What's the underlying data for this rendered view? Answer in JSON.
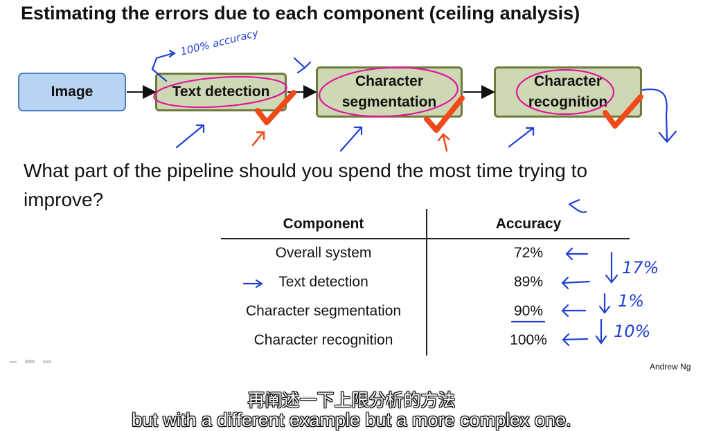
{
  "slide": {
    "title": "Estimating the errors due to each component (ceiling analysis)",
    "pipeline": {
      "image_label": "Image",
      "stages": [
        "Text detection",
        "Character segmentation",
        "Character recognition"
      ]
    },
    "question": "What part of the pipeline should you spend the most time trying to improve?",
    "table": {
      "headers": [
        "Component",
        "Accuracy"
      ],
      "rows": [
        {
          "component": "Overall system",
          "accuracy": "72%"
        },
        {
          "component": "Text detection",
          "accuracy": "89%"
        },
        {
          "component": "Character segmentation",
          "accuracy": "90%"
        },
        {
          "component": "Character recognition",
          "accuracy": "100%"
        }
      ]
    },
    "author": "Andrew Ng",
    "annotations": {
      "accuracy_note": "100% accuracy",
      "diffs": [
        "17%",
        "1%",
        "10%"
      ]
    }
  },
  "subtitles": {
    "chinese": "再阐述一下上限分析的方法",
    "english": "but with a different example but a more complex one."
  },
  "colors": {
    "ink_blue": "#1f3fd6",
    "ink_magenta": "#e0169b",
    "check_red": "#f04a1a",
    "image_box": "#b9d3f2",
    "stage_box": "#cfd8b4"
  }
}
